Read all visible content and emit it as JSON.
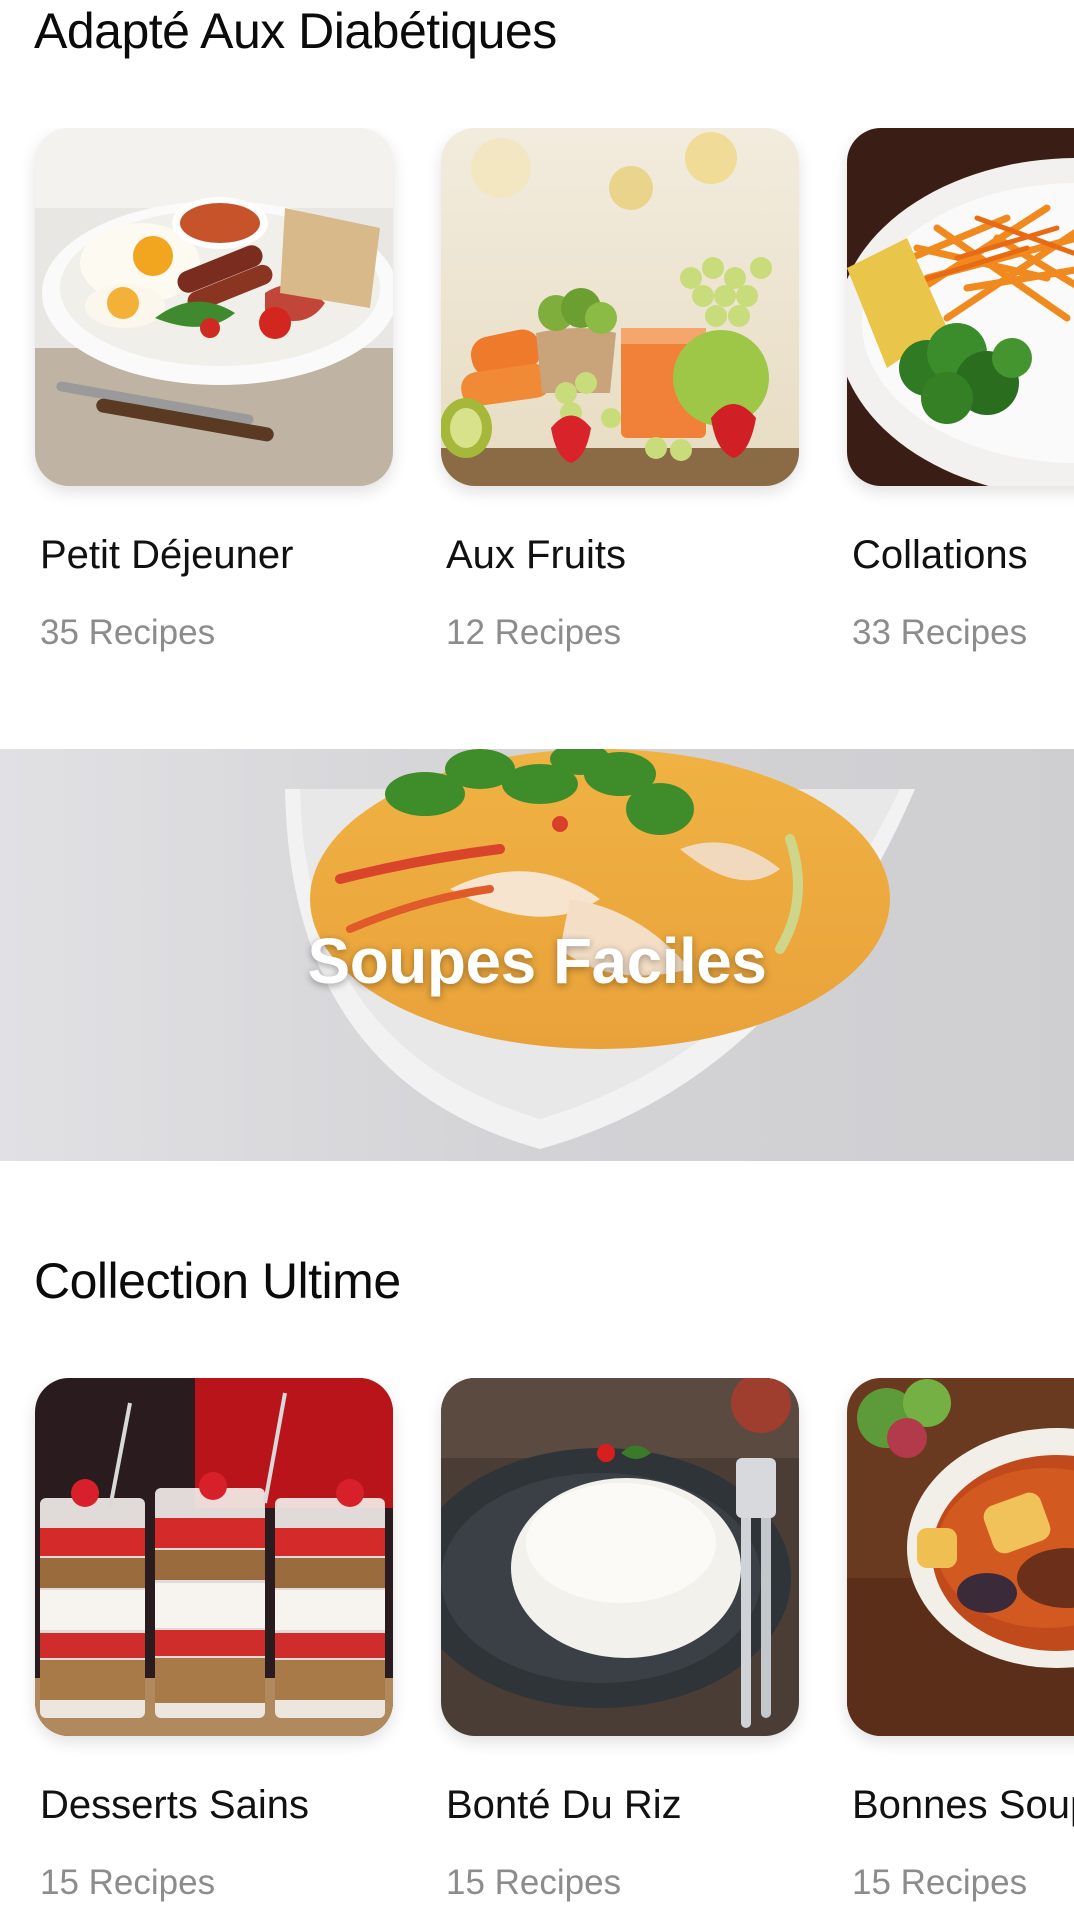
{
  "sections": {
    "diabetic": {
      "title": "Adapté Aux Diabétiques",
      "cards": [
        {
          "name": "Petit Déjeuner",
          "count": "35 Recipes",
          "image": "breakfast-plate"
        },
        {
          "name": "Aux Fruits",
          "count": "12 Recipes",
          "image": "fruits-juice"
        },
        {
          "name": "Collations",
          "count": "33 Recipes",
          "image": "carrot-salad"
        }
      ]
    },
    "banner": {
      "title": "Soupes Faciles",
      "image": "soup-bowl"
    },
    "ultimate": {
      "title": "Collection Ultime",
      "cards": [
        {
          "name": "Desserts Sains",
          "count": "15 Recipes",
          "image": "parfait-glasses"
        },
        {
          "name": "Bonté Du Riz",
          "count": "15 Recipes",
          "image": "rice-plate"
        },
        {
          "name": "Bonnes Soupes",
          "count": "15 Recipes",
          "image": "stew-bowl"
        }
      ]
    }
  },
  "colors": {
    "title": "#0b0b0b",
    "subtitle": "#8c8c8c",
    "banner_text": "#ffffff"
  }
}
